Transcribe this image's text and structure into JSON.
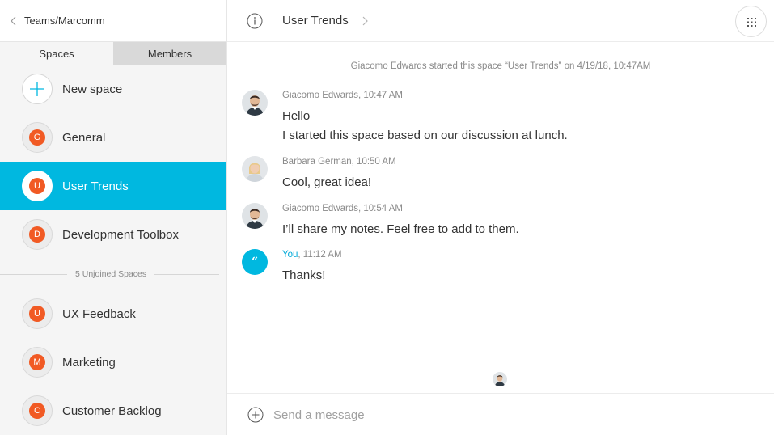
{
  "sidebar": {
    "team_title": "Teams/Marcomm",
    "tabs": [
      "Spaces",
      "Members"
    ],
    "new_space_label": "New space",
    "spaces": [
      {
        "initial": "G",
        "name": "General"
      },
      {
        "initial": "U",
        "name": "User Trends",
        "selected": true
      },
      {
        "initial": "D",
        "name": "Development Toolbox"
      }
    ],
    "unjoined_label": "5 Unjoined Spaces",
    "unjoined_spaces": [
      {
        "initial": "U",
        "name": "UX Feedback"
      },
      {
        "initial": "M",
        "name": "Marketing"
      },
      {
        "initial": "C",
        "name": "Customer Backlog"
      }
    ]
  },
  "header": {
    "title": "User Trends"
  },
  "conversation": {
    "system_message": "Giacomo Edwards started this space “User Trends” on 4/19/18, 10:47AM",
    "messages": [
      {
        "sender": "Giacomo Edwards",
        "time": "10:47 AM",
        "lines": [
          "Hello",
          "I started this space based on our discussion at lunch."
        ]
      },
      {
        "sender": "Barbara German",
        "time": "10:50 AM",
        "lines": [
          "Cool, great idea!"
        ]
      },
      {
        "sender": "Giacomo Edwards",
        "time": "10:54 AM",
        "lines": [
          "I’ll share my notes. Feel free to add to them."
        ]
      },
      {
        "sender": "You",
        "time": "11:12 AM",
        "lines": [
          "Thanks!"
        ]
      }
    ]
  },
  "composer": {
    "placeholder": "Send a message"
  },
  "colors": {
    "accent": "#00b8e0",
    "space_avatar": "#f15a24",
    "sidebar_bg": "#f5f5f5"
  },
  "icons": {
    "back": "chevron-left-icon",
    "info": "info-icon",
    "title_chevron": "chevron-right-icon",
    "apps": "grid-icon",
    "add": "plus-circle-icon"
  }
}
